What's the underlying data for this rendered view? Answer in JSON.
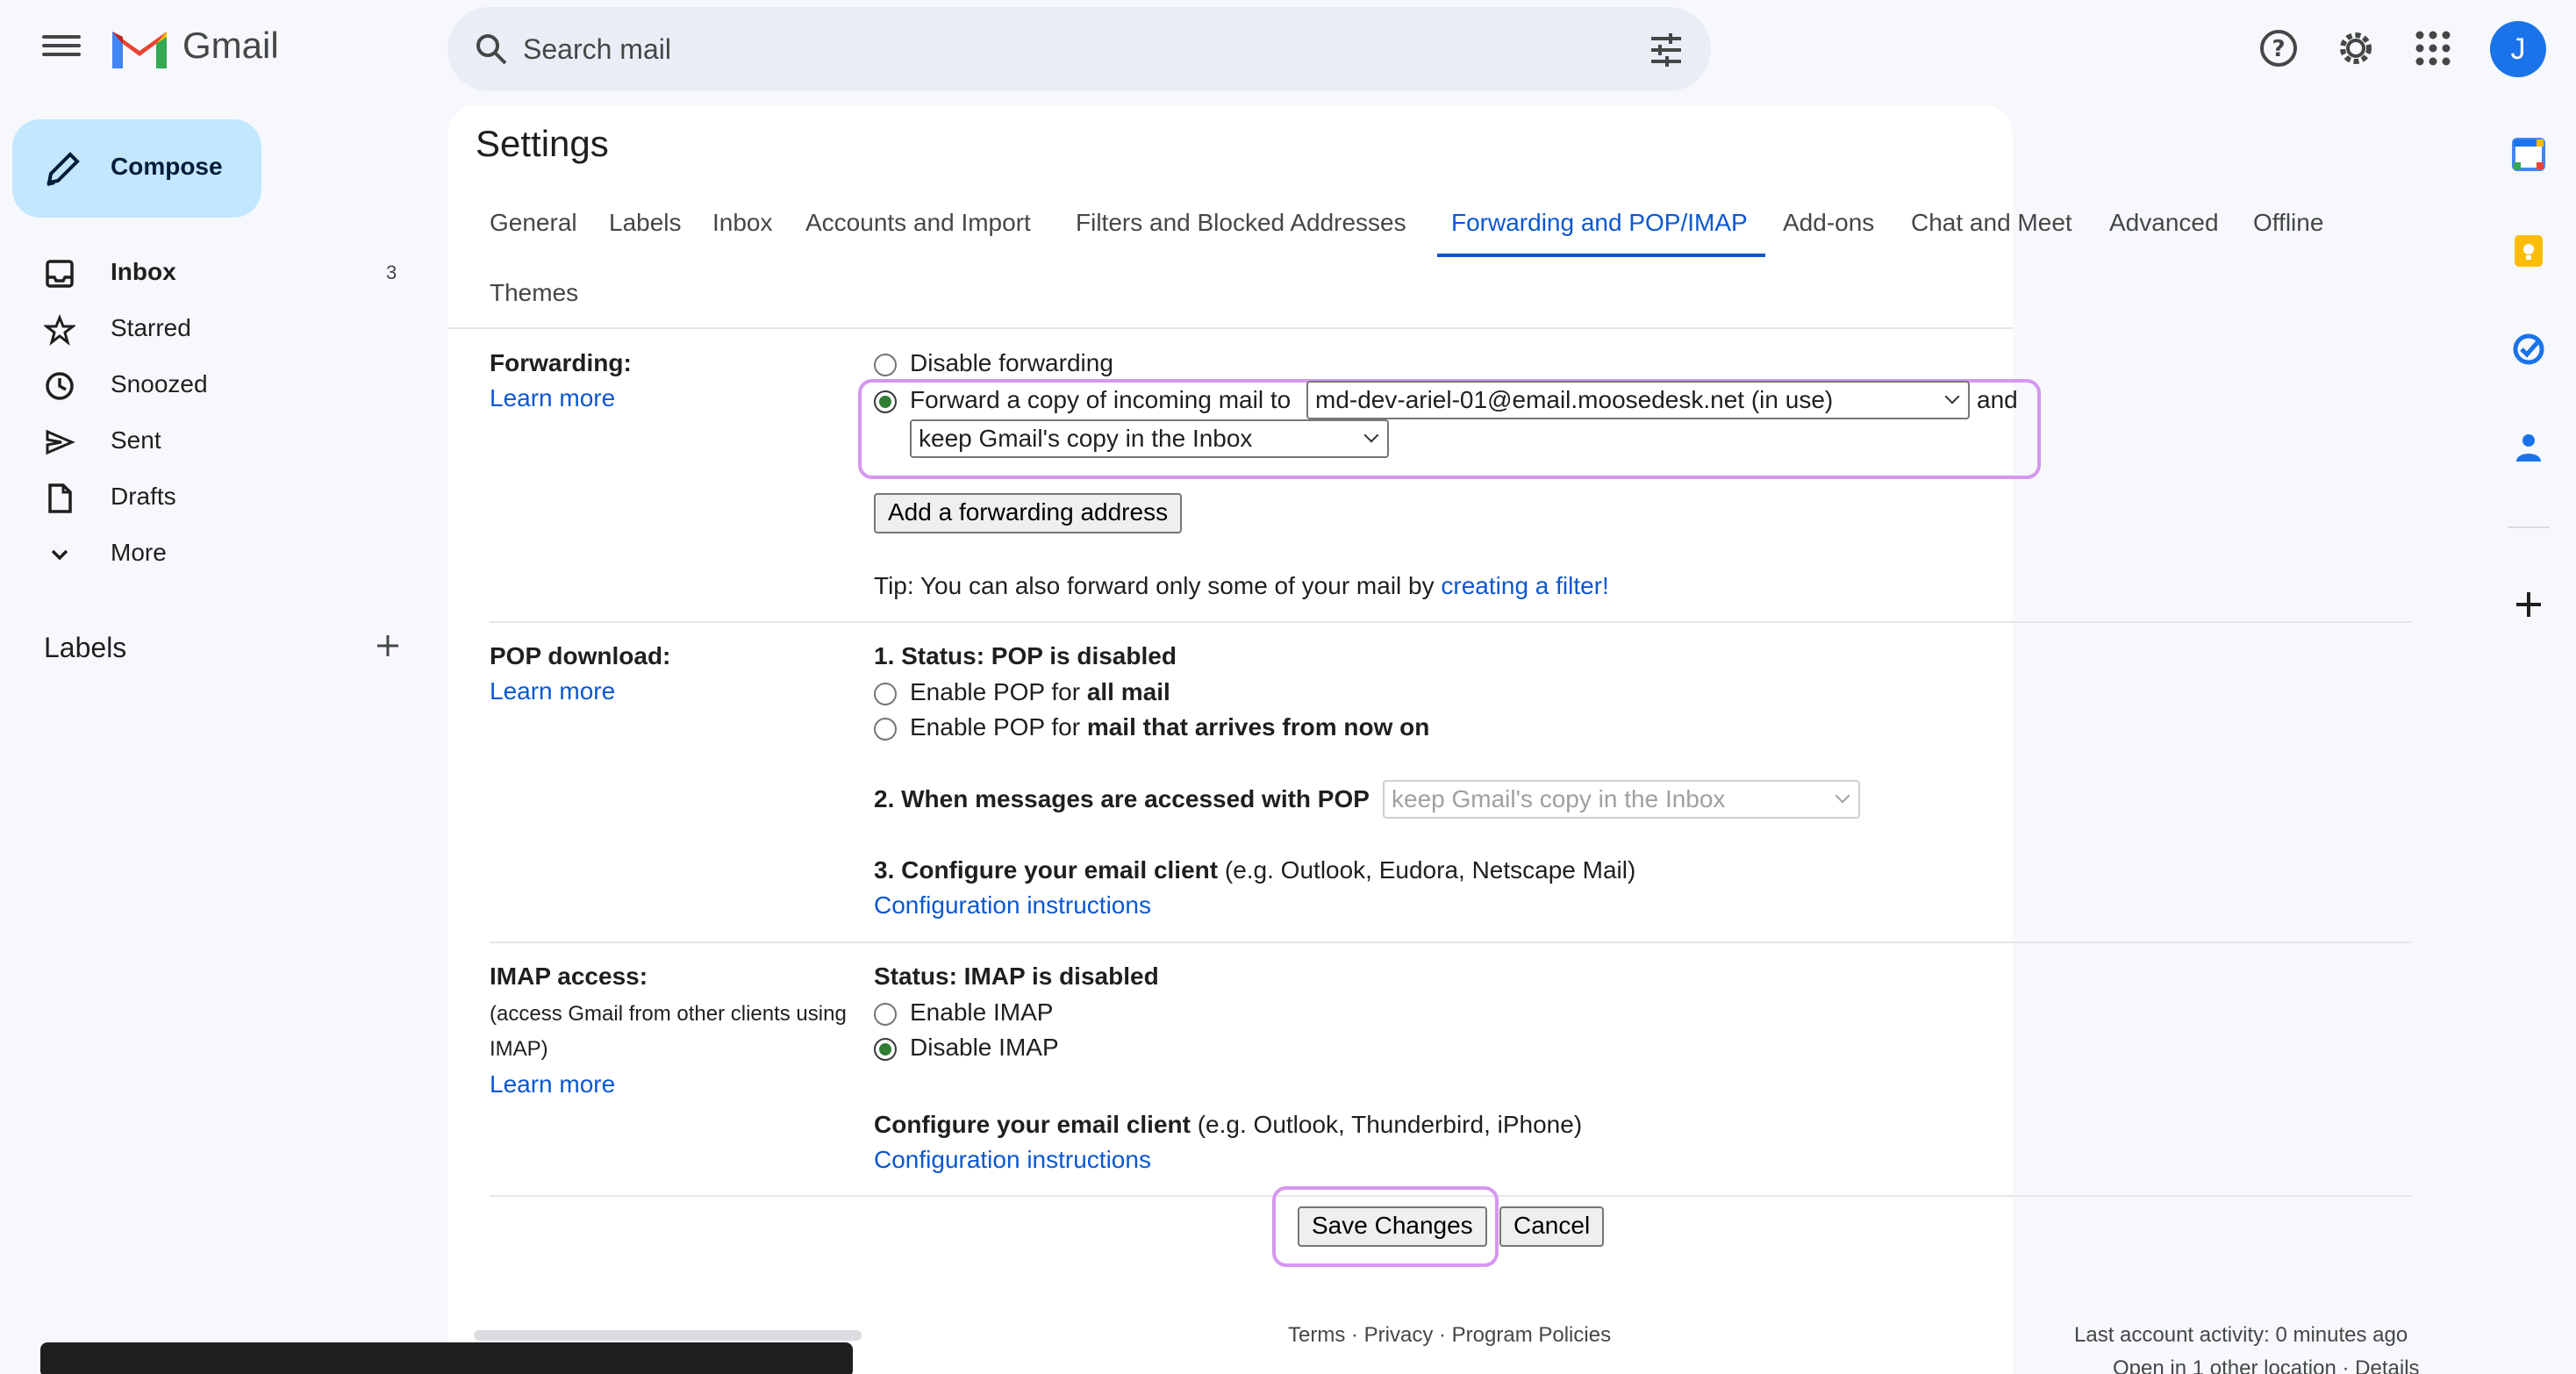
{
  "app": {
    "name": "Gmail"
  },
  "search": {
    "placeholder": "Search mail"
  },
  "avatar": {
    "initial": "J"
  },
  "compose": {
    "label": "Compose"
  },
  "nav": {
    "items": [
      {
        "label": "Inbox",
        "count": "3"
      },
      {
        "label": "Starred"
      },
      {
        "label": "Snoozed"
      },
      {
        "label": "Sent"
      },
      {
        "label": "Drafts"
      },
      {
        "label": "More"
      }
    ],
    "labels_heading": "Labels"
  },
  "settings": {
    "title": "Settings",
    "tabs": [
      "General",
      "Labels",
      "Inbox",
      "Accounts and Import",
      "Filters and Blocked Addresses",
      "Forwarding and POP/IMAP",
      "Add-ons",
      "Chat and Meet",
      "Advanced",
      "Offline",
      "Themes"
    ],
    "active_tab": "Forwarding and POP/IMAP"
  },
  "forwarding": {
    "heading": "Forwarding:",
    "learn_more": "Learn more",
    "disable_label": "Disable forwarding",
    "forward_label": "Forward a copy of incoming mail to",
    "forward_address": "md-dev-ariel-01@email.moosedesk.net (in use)",
    "and": "and",
    "copy_action": "keep Gmail's copy in the Inbox",
    "add_button": "Add a forwarding address",
    "tip_prefix": "Tip: You can also forward only some of your mail by",
    "tip_link": "creating a filter!"
  },
  "pop": {
    "heading": "POP download:",
    "learn_more": "Learn more",
    "status": "1. Status: POP is disabled",
    "enable_all_prefix": "Enable POP for",
    "enable_all_bold": "all mail",
    "enable_now_prefix": "Enable POP for",
    "enable_now_bold": "mail that arrives from now on",
    "when_accessed": "2. When messages are accessed with POP",
    "when_select": "keep Gmail's copy in the Inbox",
    "configure_bold": "3. Configure your email client",
    "configure_rest": "(e.g. Outlook, Eudora, Netscape Mail)",
    "config_link": "Configuration instructions"
  },
  "imap": {
    "heading": "IMAP access:",
    "sub1": "(access Gmail from other clients using",
    "sub2": "IMAP)",
    "learn_more": "Learn more",
    "status": "Status: IMAP is disabled",
    "enable": "Enable IMAP",
    "disable": "Disable IMAP",
    "configure_bold": "Configure your email client",
    "configure_rest": "(e.g. Outlook, Thunderbird, iPhone)",
    "config_link": "Configuration instructions"
  },
  "actions": {
    "save": "Save Changes",
    "cancel": "Cancel"
  },
  "footer": {
    "links": "Terms · Privacy · Program Policies",
    "activity": "Last account activity: 0 minutes ago",
    "other_location": "Open in 1 other location · Details"
  }
}
